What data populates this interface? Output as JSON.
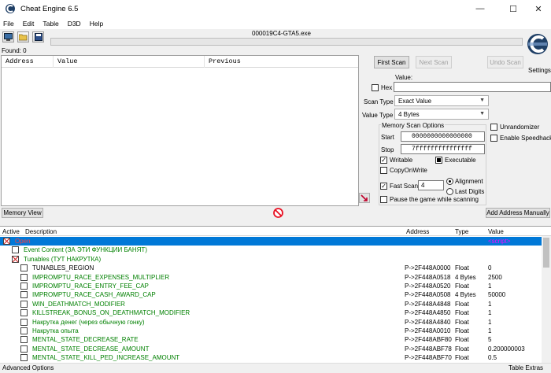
{
  "window": {
    "title": "Cheat Engine 6.5",
    "minimize": "—",
    "maximize": "☐",
    "close": "✕"
  },
  "menu": [
    "File",
    "Edit",
    "Table",
    "D3D",
    "Help"
  ],
  "process_name": "000019C4-GTA5.exe",
  "found_label": "Found: 0",
  "settings_label": "Settings",
  "results_columns": [
    "Address",
    "Value",
    "Previous"
  ],
  "scan": {
    "first_scan": "First Scan",
    "next_scan": "Next Scan",
    "undo_scan": "Undo Scan",
    "value_label": "Value:",
    "hex_label": "Hex",
    "scan_type_label": "Scan Type",
    "scan_type_value": "Exact Value",
    "value_type_label": "Value Type",
    "value_type_value": "4 Bytes",
    "memory_options_title": "Memory Scan Options",
    "start_label": "Start",
    "start_value": "0000000000000000",
    "stop_label": "Stop",
    "stop_value": "7fffffffffffffff",
    "writable": "Writable",
    "executable": "Executable",
    "copyonwrite": "CopyOnWrite",
    "fast_scan": "Fast Scan",
    "fast_scan_value": "4",
    "alignment": "Alignment",
    "last_digits": "Last Digits",
    "pause_game": "Pause the game while scanning",
    "unrandomizer": "Unrandomizer",
    "enable_speedhack": "Enable Speedhack"
  },
  "memory_view_button": "Memory View",
  "add_address_button": "Add Address Manually",
  "address_list": {
    "columns": {
      "active": "Active",
      "description": "Description",
      "address": "Address",
      "type": "Type",
      "value": "Value"
    },
    "rows": [
      {
        "description": "Open",
        "address": "",
        "type": "",
        "value": "<script>",
        "indent": 0,
        "checkbox": "x",
        "selected": true,
        "color": "#ffffff"
      },
      {
        "description": "Event Content (ЗА ЭТИ ФУНКЦИИ БАНЯТ)",
        "address": "",
        "type": "",
        "value": "",
        "indent": 1,
        "checkbox": "empty",
        "selected": false,
        "color": "#008000"
      },
      {
        "description": "Tunables (ТУТ НАКРУТКА)",
        "address": "",
        "type": "",
        "value": "",
        "indent": 1,
        "checkbox": "x",
        "selected": false,
        "color": "#008000"
      },
      {
        "description": "TUNABLES_REGION",
        "address": "P->2F448A0000",
        "type": "Float",
        "value": "0",
        "indent": 2,
        "checkbox": "empty",
        "selected": false,
        "color": "#000000"
      },
      {
        "description": "IMPROMPTU_RACE_EXPENSES_MULTIPLIER",
        "address": "P->2F448A0518",
        "type": "4 Bytes",
        "value": "2500",
        "indent": 2,
        "checkbox": "empty",
        "selected": false,
        "color": "#008000"
      },
      {
        "description": "IMPROMPTU_RACE_ENTRY_FEE_CAP",
        "address": "P->2F448A0520",
        "type": "Float",
        "value": "1",
        "indent": 2,
        "checkbox": "empty",
        "selected": false,
        "color": "#008000"
      },
      {
        "description": "IMPROMPTU_RACE_CASH_AWARD_CAP",
        "address": "P->2F448A0508",
        "type": "4 Bytes",
        "value": "50000",
        "indent": 2,
        "checkbox": "empty",
        "selected": false,
        "color": "#008000"
      },
      {
        "description": "WIN_DEATHMATCH_MODIFIER",
        "address": "P->2F448A4848",
        "type": "Float",
        "value": "1",
        "indent": 2,
        "checkbox": "empty",
        "selected": false,
        "color": "#008000"
      },
      {
        "description": "KILLSTREAK_BONUS_ON_DEATHMATCH_MODIFIER",
        "address": "P->2F448A4850",
        "type": "Float",
        "value": "1",
        "indent": 2,
        "checkbox": "empty",
        "selected": false,
        "color": "#008000"
      },
      {
        "description": "Накрутка денег (через обычную гонку)",
        "address": "P->2F448A4840",
        "type": "Float",
        "value": "1",
        "indent": 2,
        "checkbox": "empty",
        "selected": false,
        "color": "#008000"
      },
      {
        "description": "Накрутка опыта",
        "address": "P->2F448A0010",
        "type": "Float",
        "value": "1",
        "indent": 2,
        "checkbox": "empty",
        "selected": false,
        "color": "#008000"
      },
      {
        "description": "MENTAL_STATE_DECREASE_RATE",
        "address": "P->2F448ABF80",
        "type": "Float",
        "value": "5",
        "indent": 2,
        "checkbox": "empty",
        "selected": false,
        "color": "#008000"
      },
      {
        "description": "MENTAL_STATE_DECREASE_AMOUNT",
        "address": "P->2F448ABF78",
        "type": "Float",
        "value": "0.200000003",
        "indent": 2,
        "checkbox": "empty",
        "selected": false,
        "color": "#008000"
      },
      {
        "description": "MENTAL_STATE_KILL_PED_INCREASE_AMOUNT",
        "address": "P->2F448ABF70",
        "type": "Float",
        "value": "0.5",
        "indent": 2,
        "checkbox": "empty",
        "selected": false,
        "color": "#008000"
      }
    ]
  },
  "status": {
    "left": "Advanced Options",
    "right": "Table Extras"
  },
  "colors": {
    "selection": "#0078d7",
    "green_entry": "#008000",
    "script_value": "#ff00ff",
    "stop_icon": "#e81123"
  }
}
